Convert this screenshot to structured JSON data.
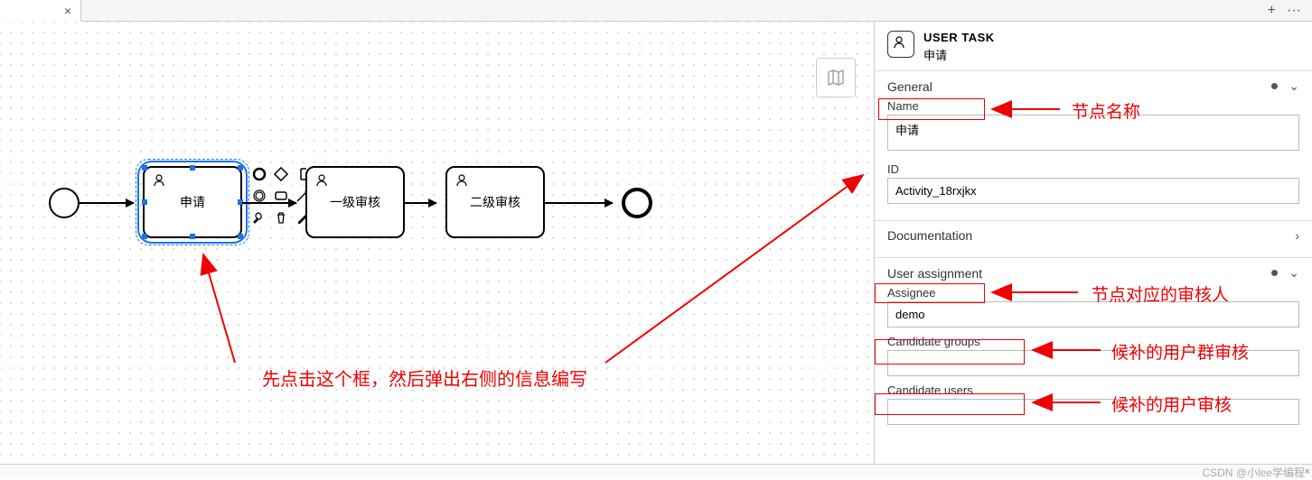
{
  "topbar": {
    "close": "×",
    "plus": "+",
    "menu": "···"
  },
  "canvas": {
    "tasks": [
      {
        "label": "申请",
        "selected": true
      },
      {
        "label": "一级审核",
        "selected": false
      },
      {
        "label": "二级审核",
        "selected": false
      }
    ],
    "context_pad": [
      "end-event-icon",
      "gateway-icon",
      "text-annotation-icon",
      "intermediate-event-icon",
      "task-icon",
      "connect-icon",
      "wrench-icon",
      "trash-icon",
      "color-icon"
    ],
    "annotation_main": "先点击这个框，然后弹出右侧的信息编写"
  },
  "panel": {
    "header": {
      "type": "USER TASK",
      "name": "申请"
    },
    "sections": {
      "general": {
        "title": "General",
        "name_label": "Name",
        "name_value": "申请",
        "id_label": "ID",
        "id_value": "Activity_18rxjkx",
        "anno_name": "节点名称"
      },
      "documentation": {
        "title": "Documentation"
      },
      "user_assignment": {
        "title": "User assignment",
        "assignee_label": "Assignee",
        "assignee_value": "demo",
        "cand_groups_label": "Candidate groups",
        "cand_groups_value": "",
        "cand_users_label": "Candidate users",
        "cand_users_value": "",
        "anno_assignee": "节点对应的审核人",
        "anno_groups": "候补的用户群审核",
        "anno_users": "候补的用户审核"
      }
    }
  },
  "footer": {
    "close": "×"
  },
  "watermark": "CSDN @小lee学编程",
  "chart_data": {
    "type": "bpmn-diagram",
    "nodes": [
      {
        "id": "start",
        "type": "startEvent"
      },
      {
        "id": "Activity_18rxjkx",
        "type": "userTask",
        "name": "申请",
        "assignee": "demo",
        "selected": true
      },
      {
        "id": "task2",
        "type": "userTask",
        "name": "一级审核"
      },
      {
        "id": "task3",
        "type": "userTask",
        "name": "二级审核"
      },
      {
        "id": "end",
        "type": "endEvent"
      }
    ],
    "flows": [
      [
        "start",
        "Activity_18rxjkx"
      ],
      [
        "Activity_18rxjkx",
        "task2"
      ],
      [
        "task2",
        "task3"
      ],
      [
        "task3",
        "end"
      ]
    ]
  }
}
